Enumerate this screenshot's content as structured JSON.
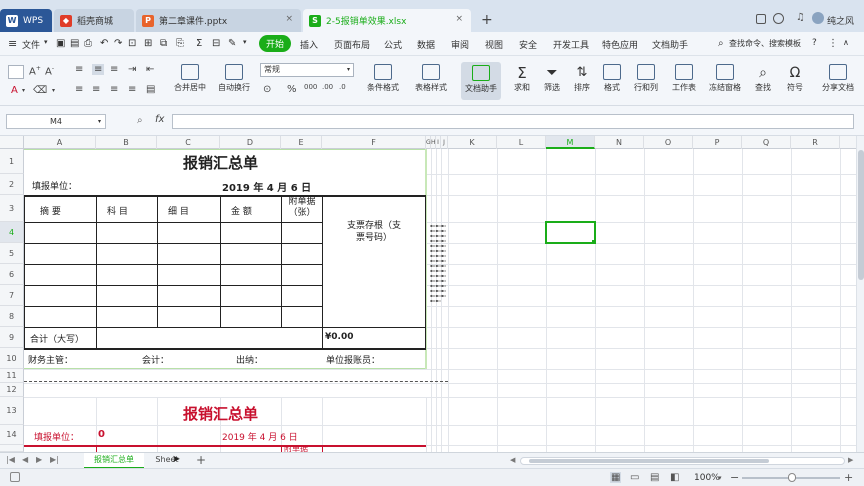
{
  "tabs": [
    {
      "label": "WPS",
      "icon": "wps-logo-icon"
    },
    {
      "label": "稻壳商城",
      "icon": "daoke-icon"
    },
    {
      "label": "第二章课件.pptx",
      "icon": "ppt-file-icon"
    },
    {
      "label": "2-5报销单效果.xlsx",
      "icon": "xlsx-file-icon"
    }
  ],
  "new_tab_label": "+",
  "user_name": "纯之风",
  "menu": {
    "file_label": "文件",
    "items": [
      "开始",
      "插入",
      "页面布局",
      "公式",
      "数据",
      "审阅",
      "视图",
      "安全",
      "开发工具",
      "特色应用",
      "文档助手"
    ],
    "search_label": "查找命令、搜索模板",
    "help_label": "?"
  },
  "ribbon": {
    "number_format": "常规",
    "merge_center": "合并居中",
    "auto_wrap": "自动换行",
    "conditional_format": "条件格式",
    "table_style": "表格样式",
    "doc_helper": "文档助手",
    "sum": "求和",
    "filter": "筛选",
    "sort": "排序",
    "format": "格式",
    "row_col": "行和列",
    "worksheet": "工作表",
    "freeze": "冻结窗格",
    "find": "查找",
    "symbol": "符号",
    "share": "分享文档"
  },
  "formula_bar": {
    "cell_ref": "M4",
    "fx": "fx",
    "value": ""
  },
  "columns": [
    "A",
    "B",
    "C",
    "D",
    "E",
    "F",
    "G",
    "H",
    "I",
    "J",
    "K",
    "L",
    "M",
    "N",
    "O",
    "P",
    "Q",
    "R"
  ],
  "rows": [
    "1",
    "2",
    "3",
    "4",
    "5",
    "6",
    "7",
    "8",
    "9",
    "10",
    "11",
    "12",
    "13",
    "14"
  ],
  "sheet": {
    "title": "报销汇总单",
    "unit_label": "填报单位：",
    "date": "2019  年  4  月  6  日",
    "col_summary": "摘      要",
    "col_subject": "科      目",
    "col_detail": "细      目",
    "col_amount": "金      额",
    "col_attach": "附单据（张）",
    "stub_label": "支票存根（支票号码）",
    "total_label": "合计（大写）",
    "total_value": "¥0.00",
    "finance": "财务主管：",
    "accounting": "会计：",
    "cashier": "出纳：",
    "reimburser": "单位报账员：",
    "title2": "报销汇总单",
    "unit_label2": "填报单位：",
    "unit_value2": "0",
    "date2": "2019  年  4  月  6  日",
    "attach2": "附单据"
  },
  "sheet_tabs": [
    "报销汇总单",
    "Sheet"
  ],
  "add_sheet": "+",
  "zoom": "100%",
  "colors": {
    "accent": "#1aad19",
    "title_red": "#c8102e",
    "titlebar": "#d9e3ef"
  }
}
